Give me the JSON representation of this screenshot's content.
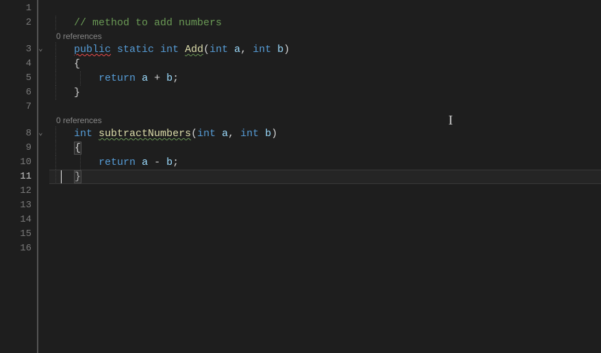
{
  "lineNumbers": [
    "1",
    "2",
    "3",
    "4",
    "5",
    "6",
    "7",
    "8",
    "9",
    "10",
    "11",
    "12",
    "13",
    "14",
    "15",
    "16"
  ],
  "activeLine": "11",
  "codelens1": "0 references",
  "codelens2": "0 references",
  "line2": {
    "comment": "// method to add numbers"
  },
  "line3": {
    "kw_public": "public",
    "kw_static": "static",
    "type": "int",
    "method": "Add",
    "lparen": "(",
    "ptype1": "int",
    "pname1": "a",
    "comma": ",",
    "ptype2": "int",
    "pname2": "b",
    "rparen": ")"
  },
  "line4": {
    "brace": "{"
  },
  "line5": {
    "kw_return": "return",
    "a": "a",
    "op": "+",
    "b": "b",
    "semi": ";"
  },
  "line6": {
    "brace": "}"
  },
  "line8": {
    "type": "int",
    "method": "subtractNumbers",
    "lparen": "(",
    "ptype1": "int",
    "pname1": "a",
    "comma": ",",
    "ptype2": "int",
    "pname2": "b",
    "rparen": ")"
  },
  "line9": {
    "brace": "{"
  },
  "line10": {
    "kw_return": "return",
    "a": "a",
    "op": "-",
    "b": "b",
    "semi": ";"
  },
  "line11": {
    "brace": "}"
  }
}
